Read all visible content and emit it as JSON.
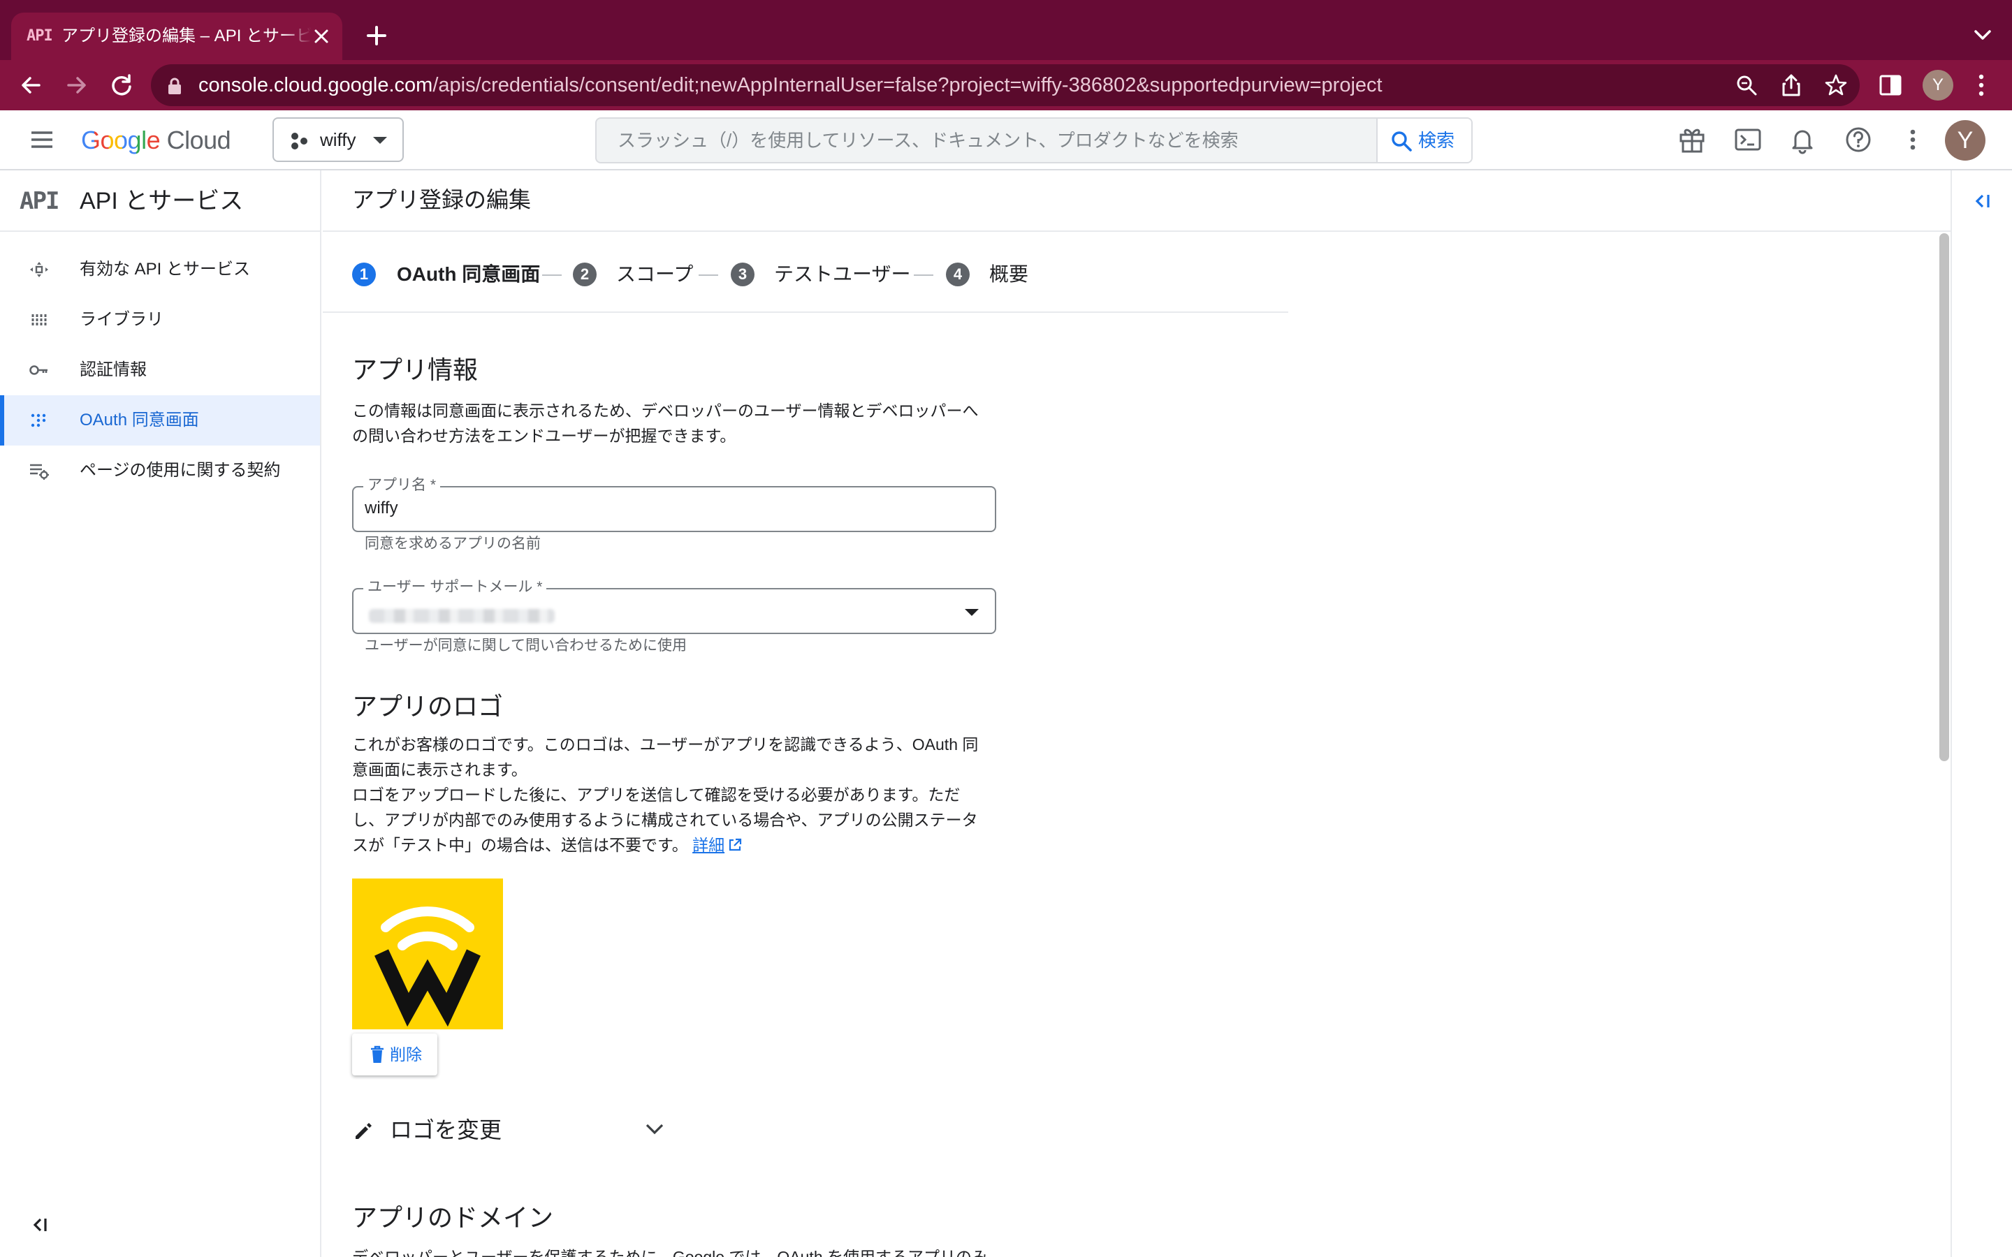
{
  "browser": {
    "tab_favicon_text": "API",
    "tab_title": "アプリ登録の編集 – API とサービス",
    "url_host": "console.cloud.google.com",
    "url_path": "/apis/credentials/consent/edit;newAppInternalUser=false?project=wiffy-386802&supportedpurview=project",
    "profile_initial": "Y"
  },
  "header": {
    "logo_google": "Google",
    "logo_cloud": "Cloud",
    "project_name": "wiffy",
    "search_placeholder": "スラッシュ（/）を使用してリソース、ドキュメント、プロダクトなどを検索",
    "search_button": "検索",
    "avatar_initial": "Y"
  },
  "sidebar": {
    "badge": "API",
    "title": "API とサービス",
    "items": [
      {
        "label": "有効な API とサービス",
        "icon": "api-hub-icon"
      },
      {
        "label": "ライブラリ",
        "icon": "library-icon"
      },
      {
        "label": "認証情報",
        "icon": "key-icon"
      },
      {
        "label": "OAuth 同意画面",
        "icon": "consent-grid-icon"
      },
      {
        "label": "ページの使用に関する契約",
        "icon": "settings-list-icon"
      }
    ],
    "active_index": 3
  },
  "main": {
    "page_title": "アプリ登録の編集",
    "steps": [
      {
        "num": "1",
        "label": "OAuth 同意画面"
      },
      {
        "num": "2",
        "label": "スコープ"
      },
      {
        "num": "3",
        "label": "テストユーザー"
      },
      {
        "num": "4",
        "label": "概要"
      }
    ],
    "app_info": {
      "heading": "アプリ情報",
      "desc_line1": "この情報は同意画面に表示されるため、デベロッパーのユーザー情報とデベロッパーへ",
      "desc_line2": "の問い合わせ方法をエンドユーザーが把握できます。",
      "app_name_label": "アプリ名 *",
      "app_name_value": "wiffy",
      "app_name_hint": "同意を求めるアプリの名前",
      "support_email_label": "ユーザー サポートメール *",
      "support_email_hint": "ユーザーが同意に関して問い合わせるために使用"
    },
    "app_logo": {
      "heading": "アプリのロゴ",
      "line1": "これがお客様のロゴです。このロゴは、ユーザーがアプリを認識できるよう、OAuth 同",
      "line2": "意画面に表示されます。",
      "line3": "ロゴをアップロードした後に、アプリを送信して確認を受ける必要があります。ただ",
      "line4": "し、アプリが内部でのみ使用するように構成されている場合や、アプリの公開ステータ",
      "line5": "スが「テスト中」の場合は、送信は不要です。",
      "details_link": "詳細",
      "delete_button": "削除",
      "change_logo": "ロゴを変更"
    },
    "app_domain": {
      "heading": "アプリのドメイン",
      "cut_text": "デベロッパーとユーザーを保護するために、Google では、OAuth を使用するアプリのみ"
    }
  },
  "colors": {
    "tab_strip": "#670b35",
    "toolbar": "#85133f",
    "accent": "#1a73e8",
    "logo_yellow": "#ffd400"
  }
}
